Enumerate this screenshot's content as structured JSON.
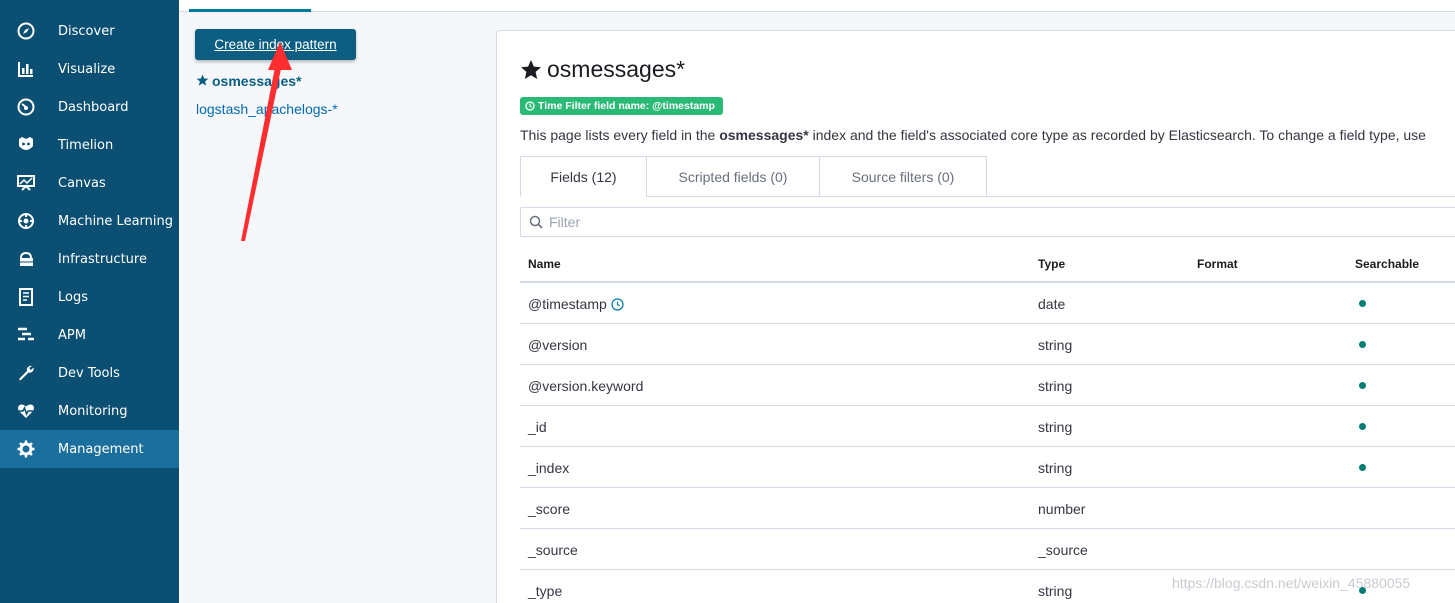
{
  "sidebar": {
    "items": [
      {
        "label": "Discover",
        "icon": "compass-icon"
      },
      {
        "label": "Visualize",
        "icon": "bar-chart-icon"
      },
      {
        "label": "Dashboard",
        "icon": "dashboard-icon"
      },
      {
        "label": "Timelion",
        "icon": "timelion-icon"
      },
      {
        "label": "Canvas",
        "icon": "canvas-icon"
      },
      {
        "label": "Machine Learning",
        "icon": "machine-learning-icon"
      },
      {
        "label": "Infrastructure",
        "icon": "infrastructure-icon"
      },
      {
        "label": "Logs",
        "icon": "logs-icon"
      },
      {
        "label": "APM",
        "icon": "apm-icon"
      },
      {
        "label": "Dev Tools",
        "icon": "wrench-icon"
      },
      {
        "label": "Monitoring",
        "icon": "heartbeat-icon"
      },
      {
        "label": "Management",
        "icon": "gear-icon",
        "active": true
      }
    ]
  },
  "left_panel": {
    "create_button": "Create index pattern",
    "index_patterns": [
      {
        "label": "osmessages*",
        "starred": true
      },
      {
        "label": "logstash_apachelogs-*",
        "starred": false
      }
    ]
  },
  "main": {
    "title": "osmessages*",
    "time_filter_badge": "Time Filter field name: @timestamp",
    "description_pre": "This page lists every field in the ",
    "description_bold": "osmessages*",
    "description_post": " index and the field's associated core type as recorded by Elasticsearch. To change a field type, use",
    "tabs": [
      {
        "label": "Fields (12)",
        "active": true
      },
      {
        "label": "Scripted fields (0)",
        "active": false
      },
      {
        "label": "Source filters (0)",
        "active": false
      }
    ],
    "filter_placeholder": "Filter",
    "table": {
      "columns": [
        "Name",
        "Type",
        "Format",
        "Searchable"
      ],
      "rows": [
        {
          "name": "@timestamp",
          "type": "date",
          "format": "",
          "searchable": true,
          "time_icon": true
        },
        {
          "name": "@version",
          "type": "string",
          "format": "",
          "searchable": true
        },
        {
          "name": "@version.keyword",
          "type": "string",
          "format": "",
          "searchable": true
        },
        {
          "name": "_id",
          "type": "string",
          "format": "",
          "searchable": true
        },
        {
          "name": "_index",
          "type": "string",
          "format": "",
          "searchable": true
        },
        {
          "name": "_score",
          "type": "number",
          "format": "",
          "searchable": false
        },
        {
          "name": "_source",
          "type": "_source",
          "format": "",
          "searchable": false
        },
        {
          "name": "_type",
          "type": "string",
          "format": "",
          "searchable": true
        }
      ]
    }
  },
  "watermark": "https://blog.csdn.net/weixin_45880055",
  "colors": {
    "sidebar_bg": "#0b4f73",
    "sidebar_active": "#1b6f9d",
    "button_bg": "#0b5d82",
    "link": "#006bb4",
    "badge": "#2bba76",
    "searchable_dot": "#017d73",
    "annotation_arrow": "#ff2d2d"
  }
}
